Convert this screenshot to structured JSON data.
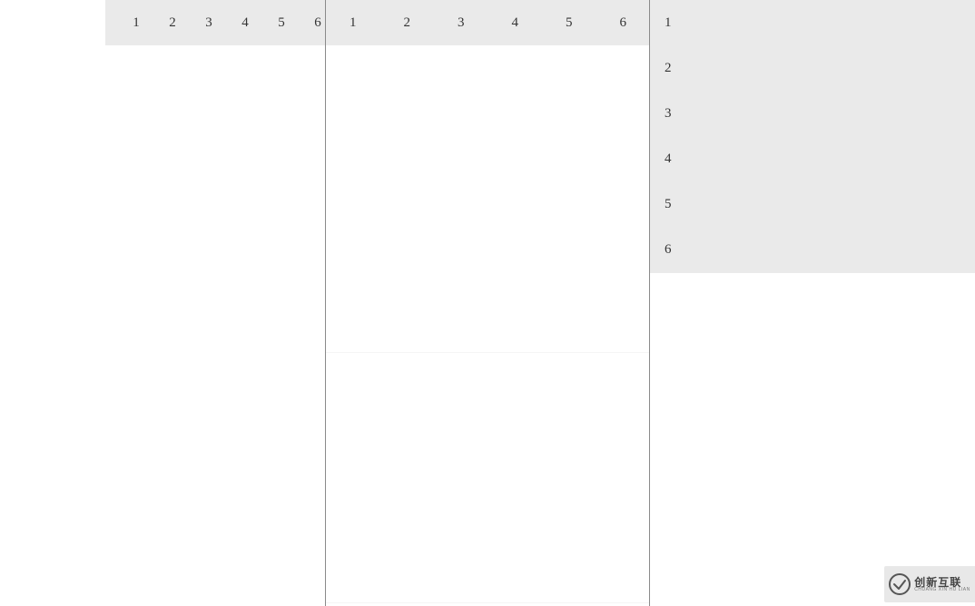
{
  "panelA": {
    "headers": [
      "1",
      "2",
      "3",
      "4",
      "5",
      "6"
    ]
  },
  "panelB": {
    "headers": [
      "1",
      "2",
      "3",
      "4",
      "5",
      "6"
    ]
  },
  "panelC": {
    "rows": [
      "1",
      "2",
      "3",
      "4",
      "5",
      "6"
    ]
  },
  "watermark": {
    "cn": "创新互联",
    "en": "CHUANG XIN HU LIAN"
  }
}
